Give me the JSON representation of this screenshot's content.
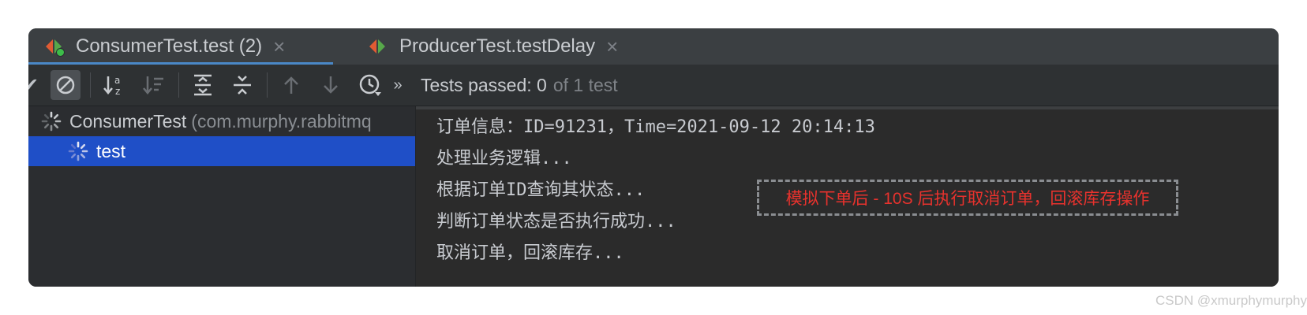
{
  "tabs": [
    {
      "label": "ConsumerTest.test (2)",
      "active": true
    },
    {
      "label": "ProducerTest.testDelay",
      "active": false
    }
  ],
  "toolbar": {
    "icons": [
      "check-icon",
      "cancel-icon",
      "sort-alpha-icon",
      "sort-duration-icon",
      "expand-all-icon",
      "collapse-all-icon",
      "arrow-up-icon",
      "arrow-down-icon",
      "history-icon",
      "more-icon"
    ],
    "status_passed": "Tests passed: 0",
    "status_total": "of 1 test"
  },
  "tree": {
    "root_label": "ConsumerTest",
    "root_package": "(com.murphy.rabbitmq",
    "child_label": "test"
  },
  "console": {
    "lines": [
      "订单信息：ID=91231，Time=2021-09-12 20:14:13",
      "处理业务逻辑...",
      "根据订单ID查询其状态...",
      "判断订单状态是否执行成功...",
      "取消订单，回滚库存..."
    ],
    "annotation": "模拟下单后 - 10S 后执行取消订单，回滚库存操作"
  },
  "watermark": "CSDN @xmurphymurphy",
  "colors": {
    "selection": "#1f4fc7",
    "annotation": "#e8322d",
    "tab_underline": "#4a88c7"
  }
}
